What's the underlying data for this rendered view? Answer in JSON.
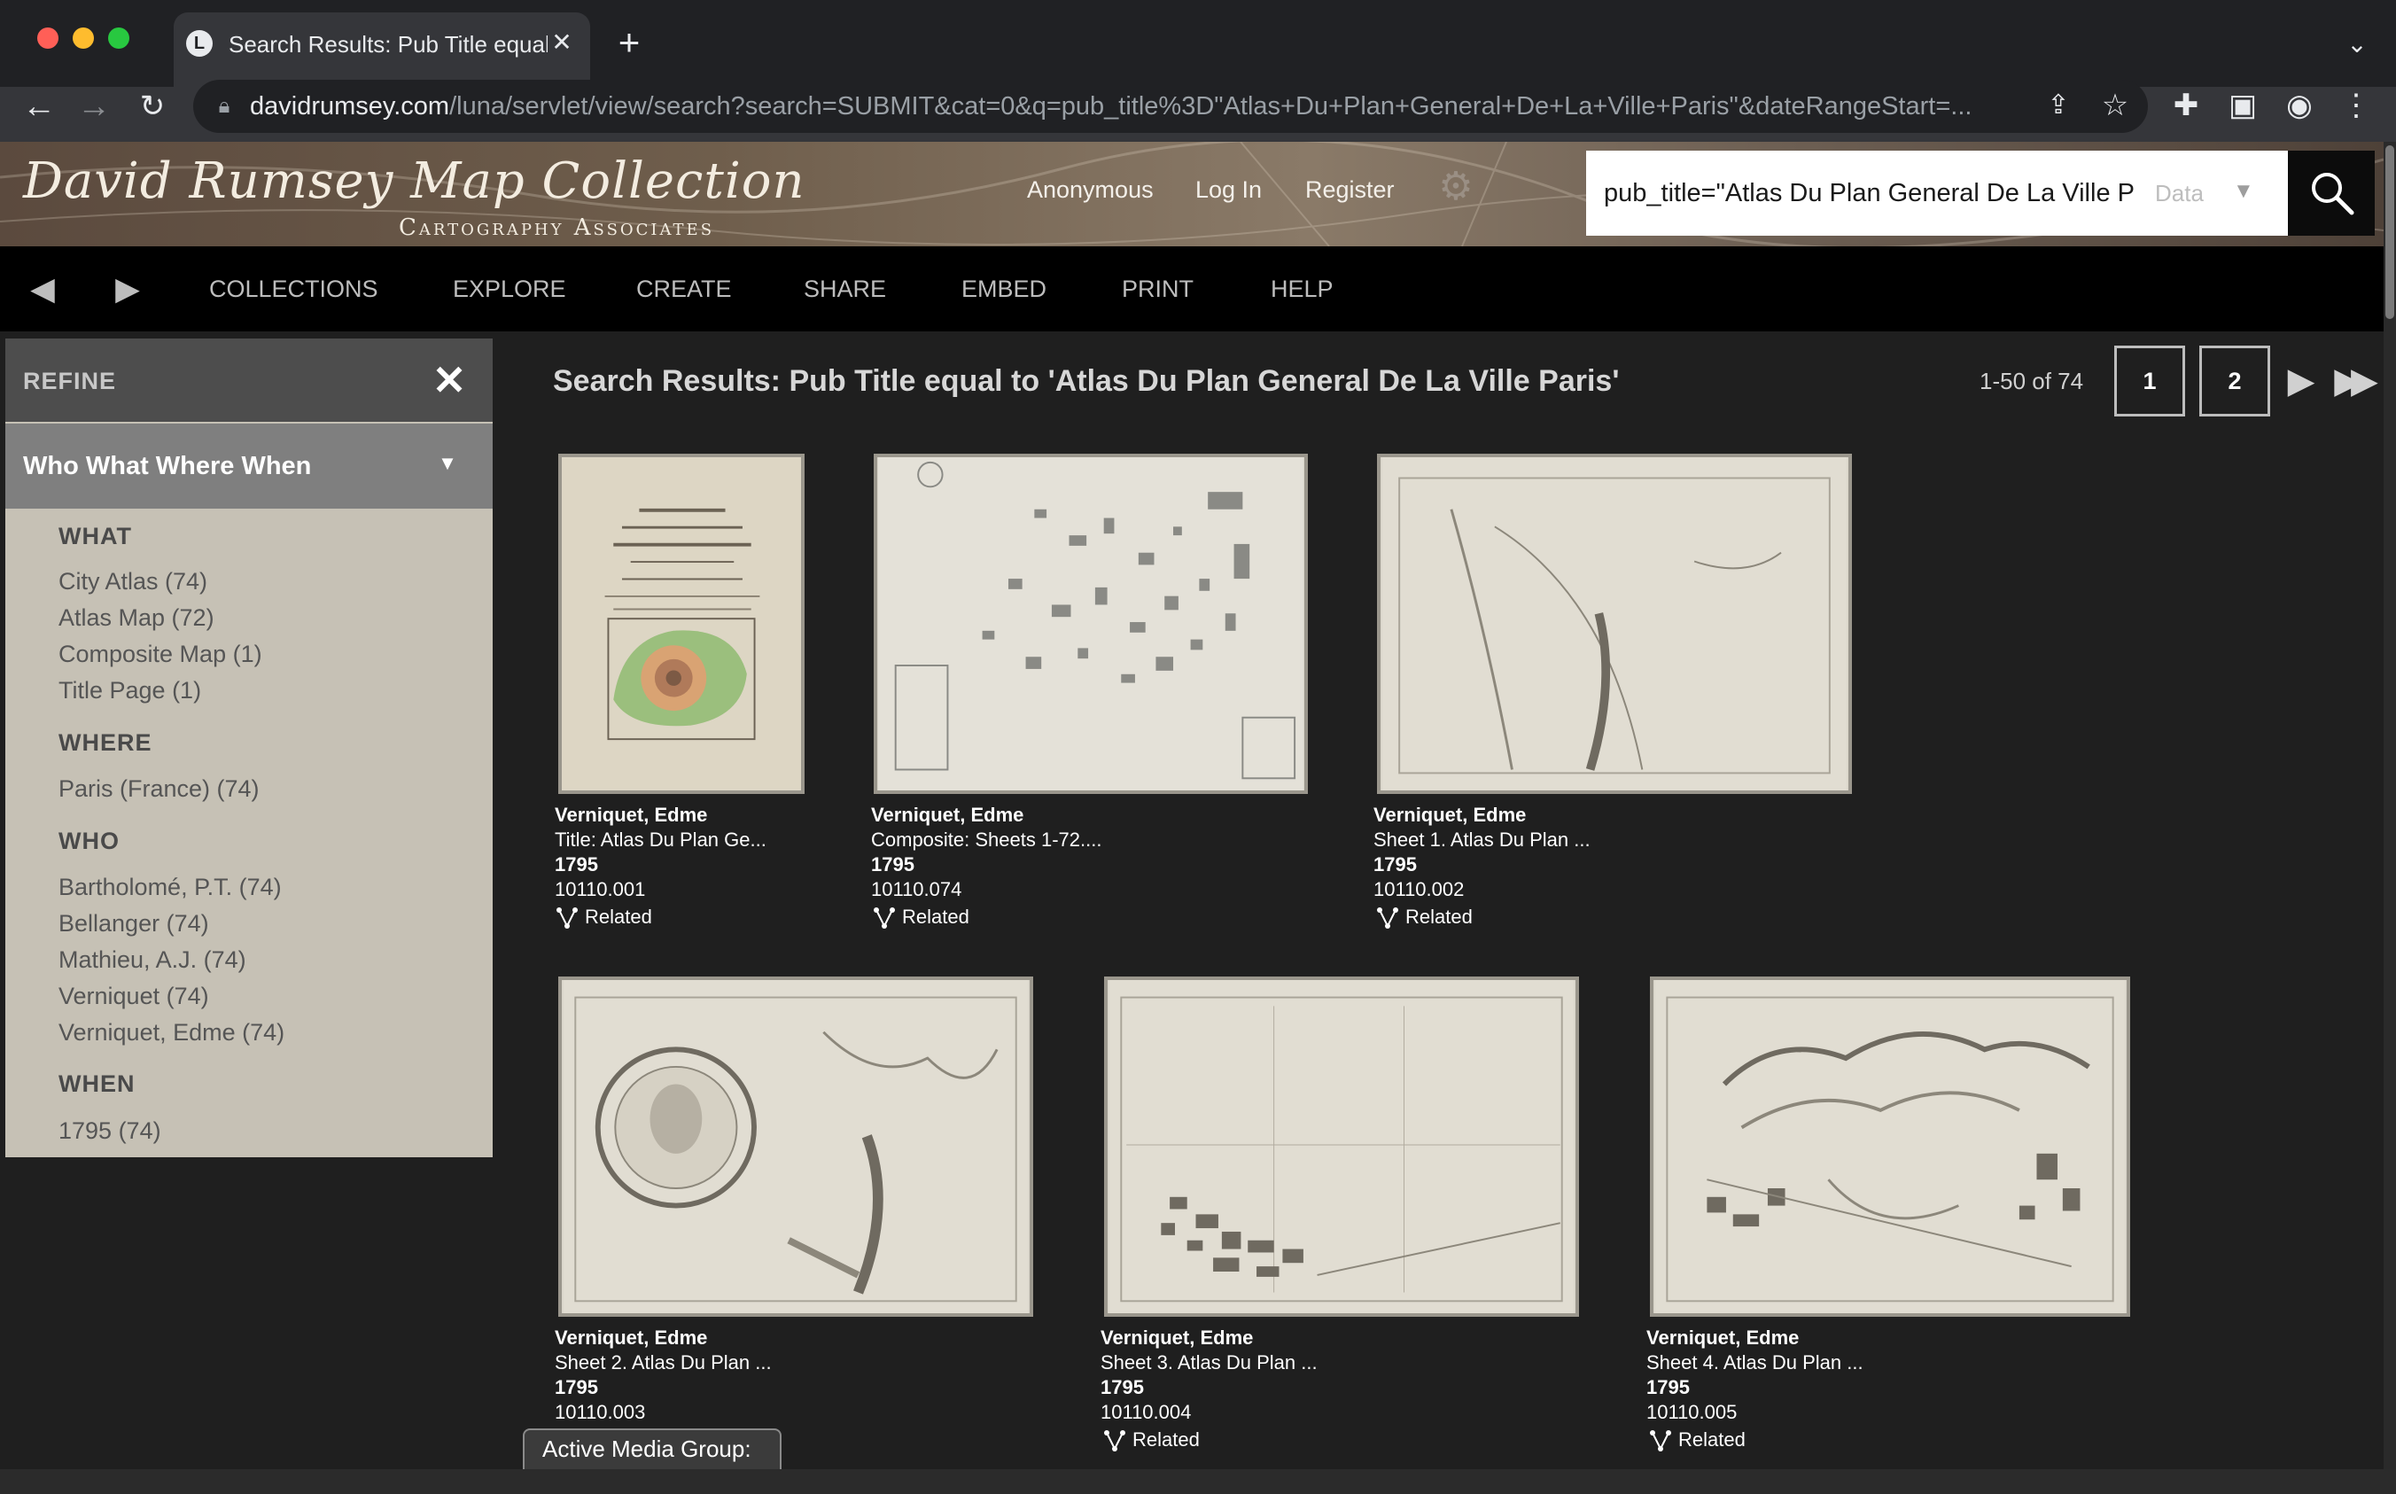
{
  "browser": {
    "tab_title": "Search Results: Pub Title equal to 'Atlas Du Plan General De La Ville Paris'",
    "tab_favicon": "L",
    "url_domain": "davidrumsey.com",
    "url_path": "/luna/servlet/view/search?search=SUBMIT&cat=0&q=pub_title%3D\"Atlas+Du+Plan+General+De+La+Ville+Paris\"&dateRangeStart=...",
    "icons": [
      "back-icon",
      "forward-icon",
      "reload-icon",
      "lock-icon",
      "share-icon",
      "star-icon",
      "extensions-icon",
      "sidepanel-icon",
      "profile-icon",
      "menu-icon"
    ],
    "colors": {
      "frame": "#202124",
      "toolbar": "#35363a",
      "traffic_red": "#ff5f57",
      "traffic_yellow": "#febc2e",
      "traffic_green": "#28c840"
    }
  },
  "header": {
    "logo_main": "David Rumsey Map Collection",
    "logo_sub": "Cartography Associates",
    "links": {
      "anonymous": "Anonymous",
      "login": "Log In",
      "register": "Register"
    },
    "search_value": "pub_title=\"Atlas Du Plan General De La Ville Paris\"",
    "search_scope": "Data"
  },
  "nav": {
    "items": [
      "COLLECTIONS",
      "EXPLORE",
      "CREATE",
      "SHARE",
      "EMBED",
      "PRINT",
      "HELP"
    ]
  },
  "refine": {
    "title": "REFINE",
    "facet_group": "Who What Where When",
    "categories": [
      {
        "name": "WHAT",
        "items": [
          "City Atlas (74)",
          "Atlas Map (72)",
          "Composite Map (1)",
          "Title Page (1)"
        ]
      },
      {
        "name": "WHERE",
        "items": [
          "Paris (France) (74)"
        ]
      },
      {
        "name": "WHO",
        "items": [
          "Bartholomé, P.T. (74)",
          "Bellanger (74)",
          "Mathieu, A.J. (74)",
          "Verniquet (74)",
          "Verniquet, Edme (74)"
        ]
      },
      {
        "name": "WHEN",
        "items": [
          "1795 (74)"
        ]
      }
    ]
  },
  "results": {
    "title": "Search Results: Pub Title equal to 'Atlas Du Plan General De La Ville Paris'",
    "count": "1-50 of 74",
    "pages": [
      "1",
      "2"
    ],
    "related_label": "Related",
    "items": [
      {
        "author": "Verniquet, Edme",
        "title": "Title: Atlas Du Plan Ge...",
        "year": "1795",
        "id": "10110.001",
        "thumb": "title-page"
      },
      {
        "author": "Verniquet, Edme",
        "title": "Composite: Sheets 1-72....",
        "year": "1795",
        "id": "10110.074",
        "thumb": "composite-map"
      },
      {
        "author": "Verniquet, Edme",
        "title": "Sheet 1. Atlas Du Plan ...",
        "year": "1795",
        "id": "10110.002",
        "thumb": "sheet-1"
      },
      {
        "author": "Verniquet, Edme",
        "title": "Sheet 2. Atlas Du Plan ...",
        "year": "1795",
        "id": "10110.003",
        "thumb": "sheet-2"
      },
      {
        "author": "Verniquet, Edme",
        "title": "Sheet 3. Atlas Du Plan ...",
        "year": "1795",
        "id": "10110.004",
        "thumb": "sheet-3"
      },
      {
        "author": "Verniquet, Edme",
        "title": "Sheet 4. Atlas Du Plan ...",
        "year": "1795",
        "id": "10110.005",
        "thumb": "sheet-4"
      }
    ]
  },
  "media_group": "Active Media Group:"
}
